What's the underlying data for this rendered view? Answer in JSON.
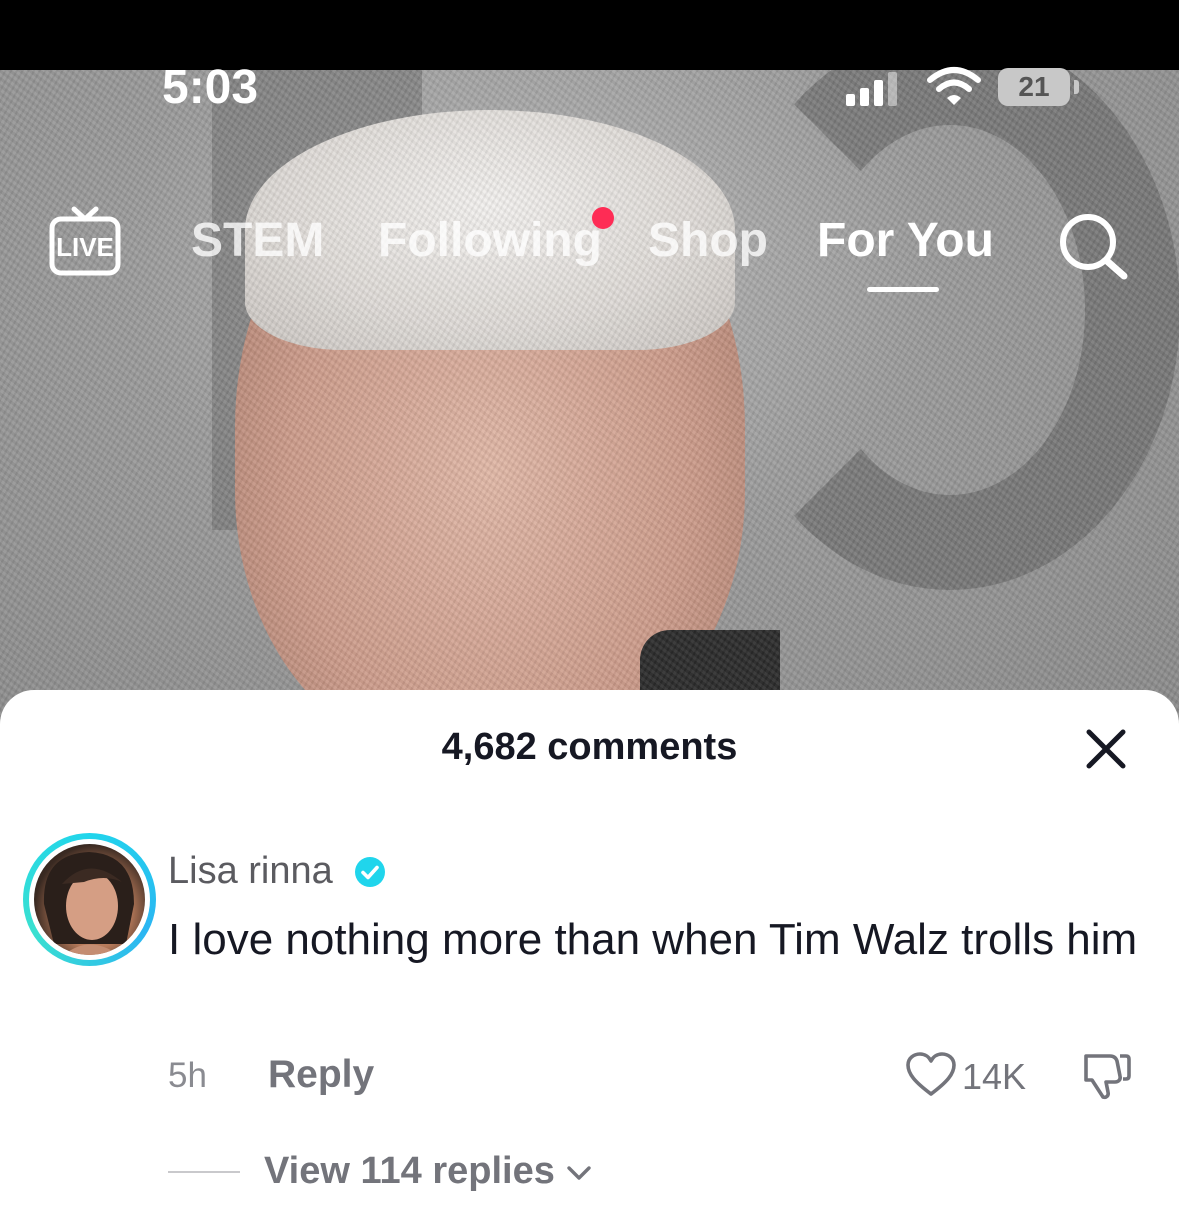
{
  "status_bar": {
    "time": "5:03",
    "battery": "21"
  },
  "nav": {
    "tabs": [
      {
        "label": "STEM"
      },
      {
        "label": "Following"
      },
      {
        "label": "Shop"
      },
      {
        "label": "For You"
      }
    ],
    "active_tab": "For You",
    "live_icon": "live-tv-icon",
    "search_icon": "search-icon",
    "notification_color": "#fe2c55"
  },
  "comments": {
    "count_title": "4,682 comments",
    "close_icon": "close-icon",
    "items": [
      {
        "username": "Lisa rinna",
        "verified": true,
        "text": "I love nothing more than when Tim Walz trolls him",
        "time": "5h",
        "reply_label": "Reply",
        "likes": "14K",
        "view_replies": "View 114 replies"
      }
    ]
  },
  "colors": {
    "verified": "#20d5ec",
    "text": "#161823",
    "muted": "#73747b"
  }
}
